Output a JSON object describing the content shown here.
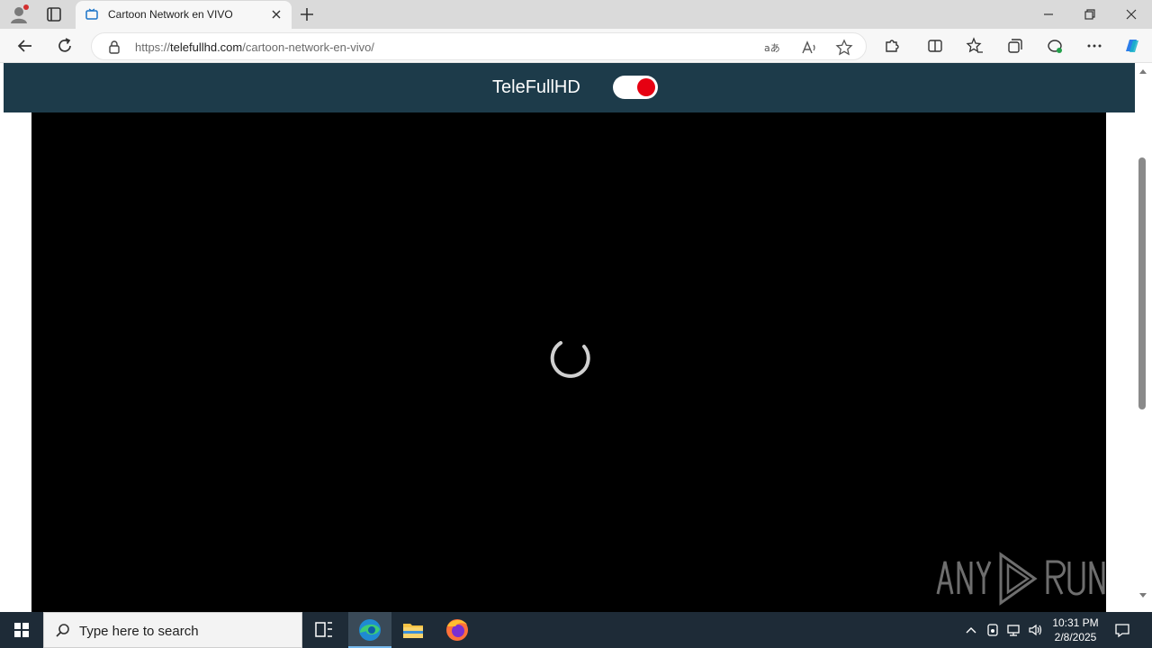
{
  "browser": {
    "tab": {
      "title": "Cartoon Network en VIVO"
    },
    "address": {
      "scheme": "https://",
      "host": "telefullhd.com",
      "path": "/cartoon-network-en-vivo/"
    }
  },
  "page": {
    "site_title": "TeleFullHD",
    "toggle": {
      "state": "on",
      "knob_color": "#e60012"
    },
    "player": {
      "state": "loading"
    },
    "header_color": "#1d3b4a"
  },
  "watermark": {
    "text": "ANY RUN"
  },
  "taskbar": {
    "search_placeholder": "Type here to search",
    "apps": [
      "task-view",
      "edge",
      "file-explorer",
      "firefox"
    ],
    "clock": {
      "time": "10:31 PM",
      "date": "2/8/2025"
    }
  }
}
